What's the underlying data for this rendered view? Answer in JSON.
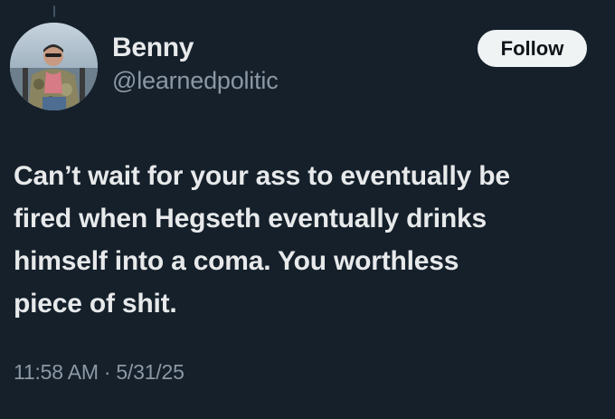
{
  "author": {
    "name": "Benny",
    "handle": "@learnedpolitic"
  },
  "follow_button": {
    "label": "Follow"
  },
  "tweet": {
    "lines": [
      "Can’t wait for your ass to eventually be",
      "fired when Hegseth eventually drinks",
      "himself into a coma. You worthless",
      "piece of shit."
    ],
    "time": "11:58 AM",
    "separator": "·",
    "date": "5/31/25"
  },
  "colors": {
    "background": "#15202b",
    "text": "#e7e9ea",
    "muted": "#8b98a5",
    "button_bg": "#eff3f4"
  }
}
